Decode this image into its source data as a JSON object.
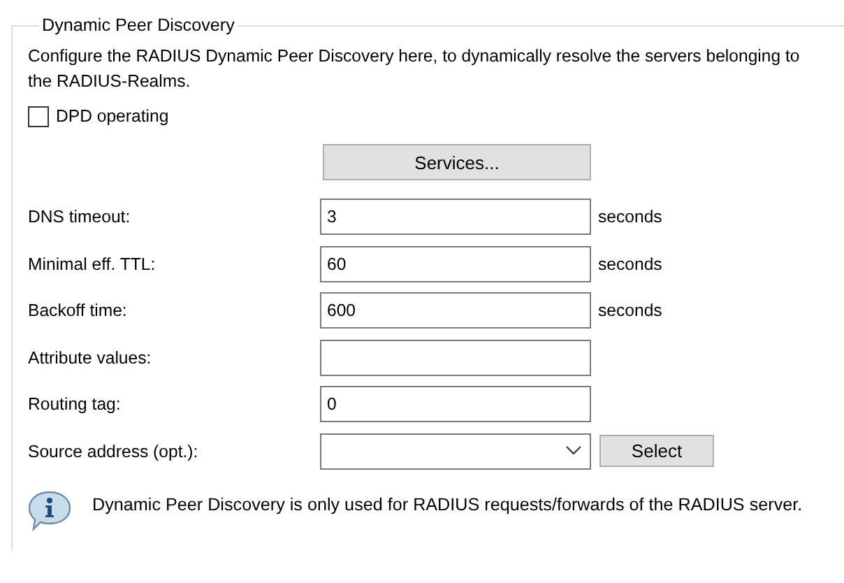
{
  "group": {
    "title": "Dynamic Peer Discovery",
    "description": "Configure the RADIUS Dynamic Peer Discovery here, to dynamically resolve the servers belonging to the RADIUS-Realms.",
    "checkbox": {
      "label": "DPD operating",
      "checked": false
    },
    "services_button": "Services...",
    "fields": [
      {
        "kind": "text",
        "label": "DNS timeout:",
        "value": "3",
        "unit": "seconds"
      },
      {
        "kind": "text",
        "label": "Minimal eff. TTL:",
        "value": "60",
        "unit": "seconds"
      },
      {
        "kind": "text",
        "label": "Backoff time:",
        "value": "600",
        "unit": "seconds"
      },
      {
        "kind": "text",
        "label": "Attribute values:"
      },
      {
        "kind": "text",
        "label": "Routing tag:",
        "value": "0"
      },
      {
        "kind": "combo",
        "label": "Source address (opt.):",
        "button": "Select"
      }
    ],
    "note": "Dynamic Peer Discovery is only used for RADIUS requests/forwards of the RADIUS server."
  }
}
